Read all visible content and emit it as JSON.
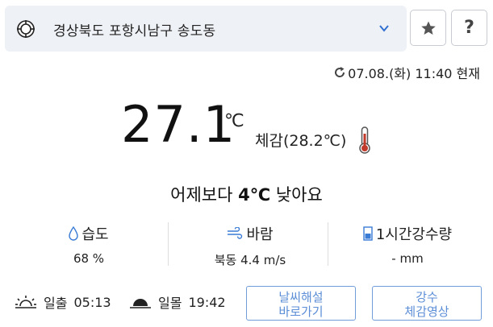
{
  "location": {
    "name": "경상북도 포항시남구 송도동"
  },
  "header": {
    "help_label": "?"
  },
  "updated": {
    "text": "07.08.(화) 11:40 현재"
  },
  "current": {
    "temperature": "27.1",
    "unit": "℃",
    "feels_like": "체감(28.2℃)"
  },
  "comparison": {
    "prefix": "어제보다 ",
    "amount": "4℃",
    "suffix": " 낮아요"
  },
  "stats": {
    "humidity": {
      "label": "습도",
      "value": "68 %"
    },
    "wind": {
      "label": "바람",
      "value": "북동 4.4 m/s"
    },
    "rain": {
      "label": "1시간강수량",
      "value": "- mm"
    }
  },
  "sun": {
    "sunrise_label": "일출",
    "sunrise_time": "05:13",
    "sunset_label": "일몰",
    "sunset_time": "19:42"
  },
  "buttons": {
    "weather_explain": [
      "날씨해설",
      "바로가기"
    ],
    "rain_video": [
      "강수",
      "체감영상"
    ]
  },
  "colors": {
    "accent_blue": "#5b8ed6",
    "location_bg": "#eef1f6",
    "thermo_red": "#c0392b"
  }
}
